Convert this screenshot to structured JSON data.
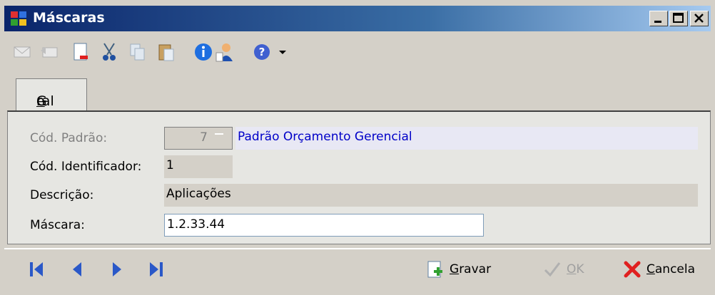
{
  "window": {
    "title": "Máscaras"
  },
  "toolbar": {
    "icons": [
      "envelope-icon",
      "reply-icon",
      "new-document-icon",
      "cut-icon",
      "copy-icon",
      "paste-icon",
      "info-icon",
      "user-icon",
      "help-icon",
      "dropdown-arrow-icon"
    ]
  },
  "tabs": [
    {
      "label_prefix": "G",
      "label_underlined": "e",
      "label_suffix": "ral"
    }
  ],
  "form": {
    "standard_code": {
      "label": "Cód. Padrão:",
      "value": "7",
      "description": "Padrão Orçamento Gerencial"
    },
    "identifier": {
      "label": "Cód. Identificador:",
      "value": "1"
    },
    "description": {
      "label": "Descrição:",
      "value": "Aplicações"
    },
    "mask": {
      "label": "Máscara:",
      "value": "1.2.33.44"
    }
  },
  "actions": {
    "save": {
      "label_underlined": "G",
      "label_rest": "ravar"
    },
    "ok": {
      "label_underlined": "O",
      "label_rest": "K"
    },
    "cancel": {
      "label_underlined": "C",
      "label_rest": "ancela"
    }
  },
  "colors": {
    "title_start": "#0a246a",
    "title_end": "#a6caf0",
    "link_text": "#0000c8",
    "cancel_x": "#e02020"
  }
}
